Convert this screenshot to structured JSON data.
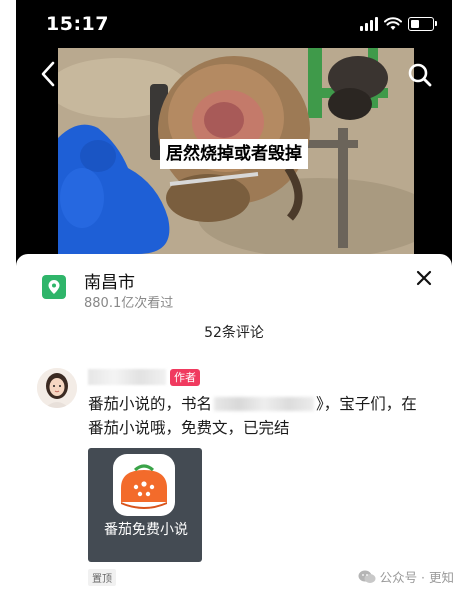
{
  "status_bar": {
    "time": "15:17"
  },
  "video": {
    "caption": "居然烧掉或者毁掉"
  },
  "location": {
    "title": "南昌市",
    "views": "880.1亿次看过",
    "icon": "location-pin-icon",
    "icon_color": "#2fb56a"
  },
  "comments": {
    "count_label": "52条评论"
  },
  "comment": {
    "author_badge": "作者",
    "text_before": "番茄小说的，书名",
    "text_after": "》，宝子们，在番茄小说哦，免费文，已完结",
    "card_title": "番茄免费小说",
    "pinned_label": "置顶",
    "badge_color": "#f03a5f"
  },
  "watermark": {
    "text": "公众号 · 更知"
  }
}
